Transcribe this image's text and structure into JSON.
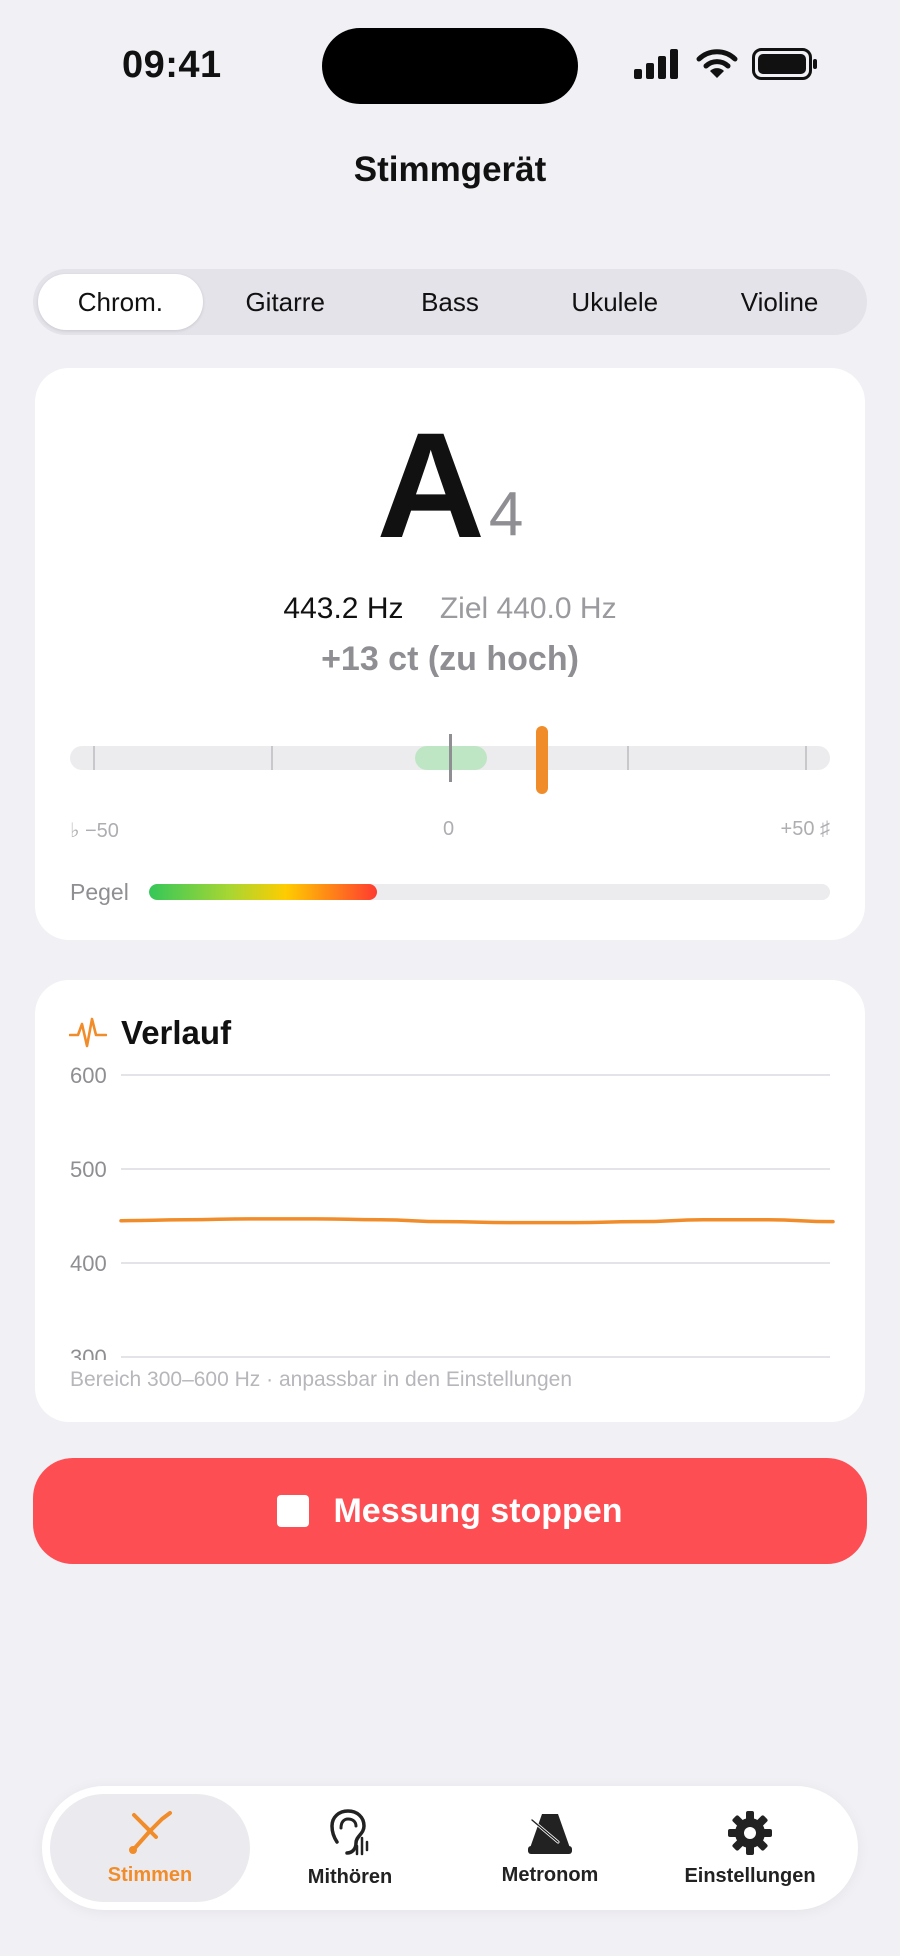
{
  "status_bar": {
    "time": "09:41"
  },
  "nav": {
    "title": "Stimmgerät"
  },
  "segments": [
    {
      "label": "Chrom.",
      "active": true
    },
    {
      "label": "Gitarre",
      "active": false
    },
    {
      "label": "Bass",
      "active": false
    },
    {
      "label": "Ukulele",
      "active": false
    },
    {
      "label": "Violine",
      "active": false
    }
  ],
  "tuner": {
    "note": "A",
    "octave": "4",
    "frequency": "443.2 Hz",
    "target": "Ziel 440.0 Hz",
    "cents_text": "+13 ct (zu hoch)",
    "cents_value": 13,
    "scale": {
      "min_label": "♭ −50",
      "center_label": "0",
      "max_label": "+50 ♯"
    },
    "level_label": "Pegel",
    "level_fraction": 0.335
  },
  "history": {
    "title": "Verlauf",
    "note": "Bereich 300–600 Hz · anpassbar in den Einstellungen"
  },
  "chart_data": {
    "type": "line",
    "ylim": [
      300,
      600
    ],
    "yticks": [
      "600",
      "500",
      "400",
      "300"
    ],
    "series": [
      {
        "values": [
          445,
          446,
          447,
          447,
          446,
          444,
          443,
          443,
          444,
          446,
          446,
          444
        ]
      }
    ],
    "color": "#f18c2a"
  },
  "stop_button": {
    "label": "Messung stoppen"
  },
  "tabbar": [
    {
      "label": "Stimmen",
      "icon": "tuning-fork-icon",
      "active": true
    },
    {
      "label": "Mithören",
      "icon": "ear-icon",
      "active": false
    },
    {
      "label": "Metronom",
      "icon": "metronome-icon",
      "active": false
    },
    {
      "label": "Einstellungen",
      "icon": "gear-icon",
      "active": false
    }
  ],
  "colors": {
    "accent": "#f18c2a",
    "stop": "#fd4e54",
    "in_tune": "#34c759"
  }
}
